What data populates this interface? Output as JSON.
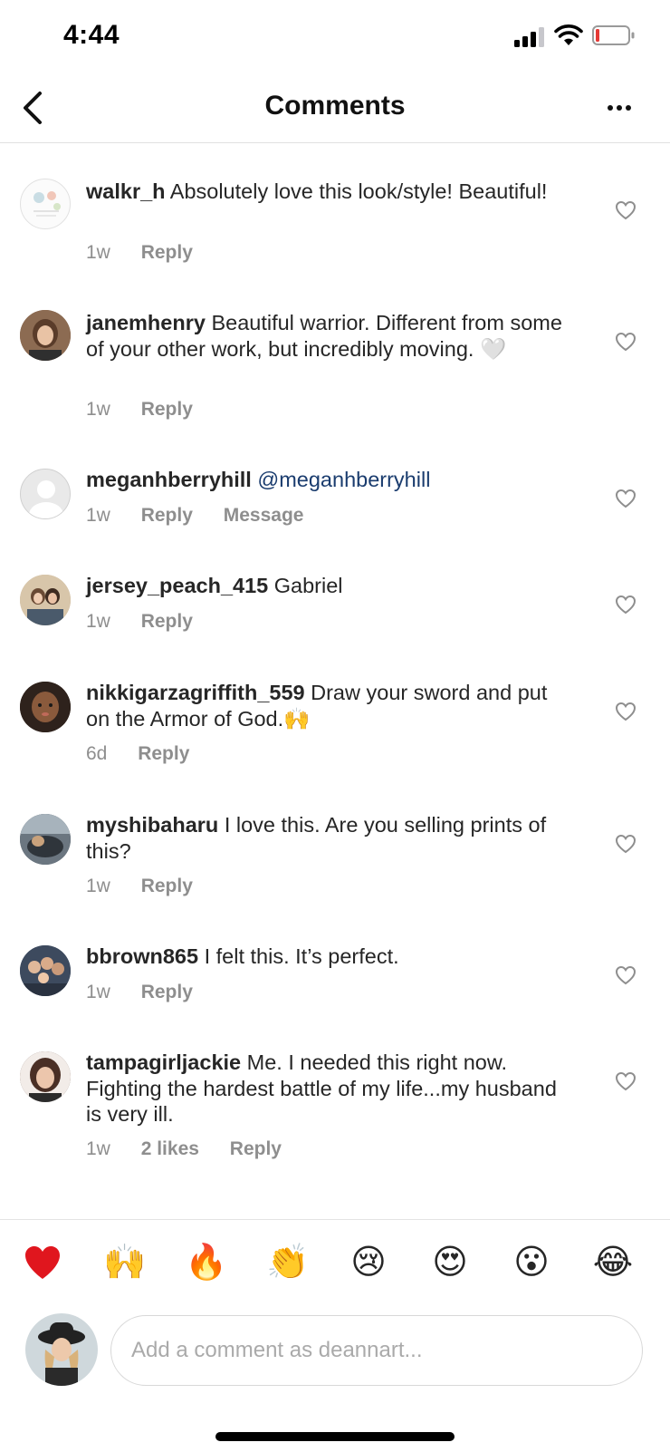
{
  "status_bar": {
    "time": "4:44"
  },
  "header": {
    "title": "Comments"
  },
  "comments": [
    {
      "username": "walkr_h",
      "text": "Absolutely love this look/style! Beautiful!",
      "time": "1w",
      "actions": [
        "Reply"
      ]
    },
    {
      "username": "janemhenry",
      "text": "Beautiful warrior. Different from some of your other work, but incredibly moving. 🤍",
      "time": "1w",
      "actions": [
        "Reply"
      ]
    },
    {
      "username": "meganhberryhill",
      "mention": "@meganhberryhill",
      "time": "1w",
      "actions": [
        "Reply",
        "Message"
      ]
    },
    {
      "username": "jersey_peach_415",
      "text": "Gabriel",
      "time": "1w",
      "actions": [
        "Reply"
      ]
    },
    {
      "username": "nikkigarzagriffith_559",
      "text": "Draw your sword and put on the Armor of God.🙌",
      "time": "6d",
      "actions": [
        "Reply"
      ]
    },
    {
      "username": "myshibaharu",
      "text": "I love this. Are you selling prints of this?",
      "time": "1w",
      "actions": [
        "Reply"
      ]
    },
    {
      "username": "bbrown865",
      "text": "I felt this. It’s perfect.",
      "time": "1w",
      "actions": [
        "Reply"
      ]
    },
    {
      "username": "tampagirljackie",
      "text": "Me. I needed this right now. Fighting the hardest battle of my life...my husband is very ill.",
      "time": "1w",
      "likes": "2 likes",
      "actions": [
        "Reply"
      ]
    }
  ],
  "emoji_bar": [
    "❤️",
    "🙌",
    "🔥",
    "👏",
    "😢",
    "😍",
    "😮",
    "😂"
  ],
  "input": {
    "placeholder": "Add a comment as deannart..."
  },
  "colors": {
    "text": "#262626",
    "meta": "#8e8e8e",
    "mention": "#1a3c6e",
    "battery_low": "#e53935"
  }
}
